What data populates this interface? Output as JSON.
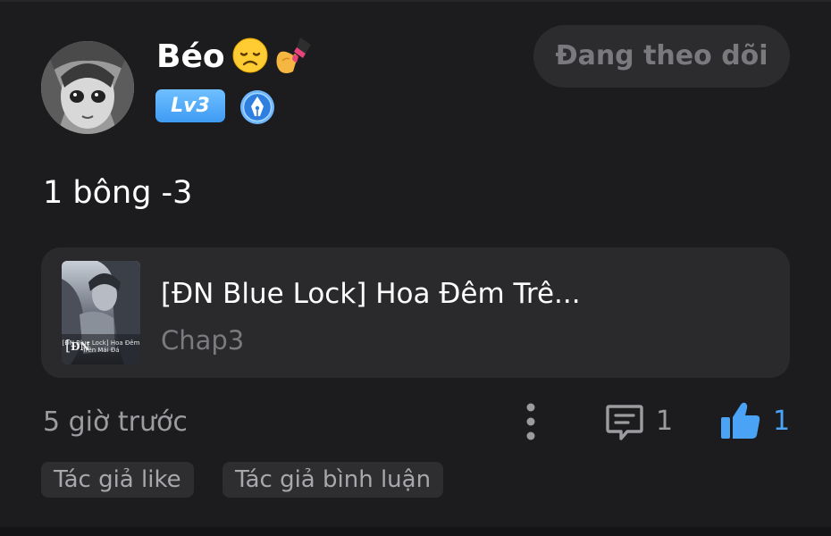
{
  "post": {
    "author": {
      "name": "Béo",
      "emojis": [
        "disappointed-face-emoji",
        "nail-polish-emoji"
      ],
      "level": "Lv3",
      "badge_icon": "pen-nib-badge-icon"
    },
    "follow_button_label": "Đang theo dõi",
    "text": "1 bông -3",
    "story": {
      "title": "[ĐN Blue Lock] Hoa Đêm Trê...",
      "chapter": "Chap3",
      "cover_caption_line1": "[ĐN Blue Lock] Hoa Đêm",
      "cover_caption_line2": "Trên Mái Đá"
    },
    "timestamp": "5 giờ trước",
    "comment_count": "1",
    "like_count": "1",
    "tags": [
      "Tác giả like",
      "Tác giả bình luận"
    ]
  },
  "colors": {
    "background": "#1c1c1e",
    "card": "#2a2a2c",
    "accent_blue": "#4aa3f5",
    "level_badge": "#3f9bf4",
    "muted_text": "#9c9ca0"
  }
}
